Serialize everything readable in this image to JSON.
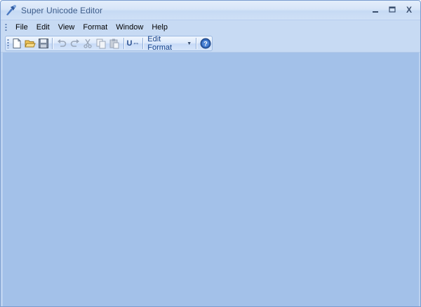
{
  "window": {
    "title": "Super Unicode Editor",
    "controls": {
      "minimize": "‒",
      "maximize": "□",
      "close": "X"
    }
  },
  "menubar": {
    "items": [
      {
        "label": "File"
      },
      {
        "label": "Edit"
      },
      {
        "label": "View"
      },
      {
        "label": "Format"
      },
      {
        "label": "Window"
      },
      {
        "label": "Help"
      }
    ]
  },
  "toolbar": {
    "buttons": [
      "new-file-icon",
      "open-folder-icon",
      "save-icon",
      "undo-icon",
      "redo-icon",
      "cut-icon",
      "copy-icon",
      "paste-icon",
      "unicode-convert-icon",
      "help-icon"
    ],
    "edit_format_label": "Edit Format",
    "unicode_button_label": "U⇔"
  },
  "colors": {
    "workspace": "#a3c1e9",
    "chrome": "#c7daf3",
    "accent": "#15428b"
  }
}
